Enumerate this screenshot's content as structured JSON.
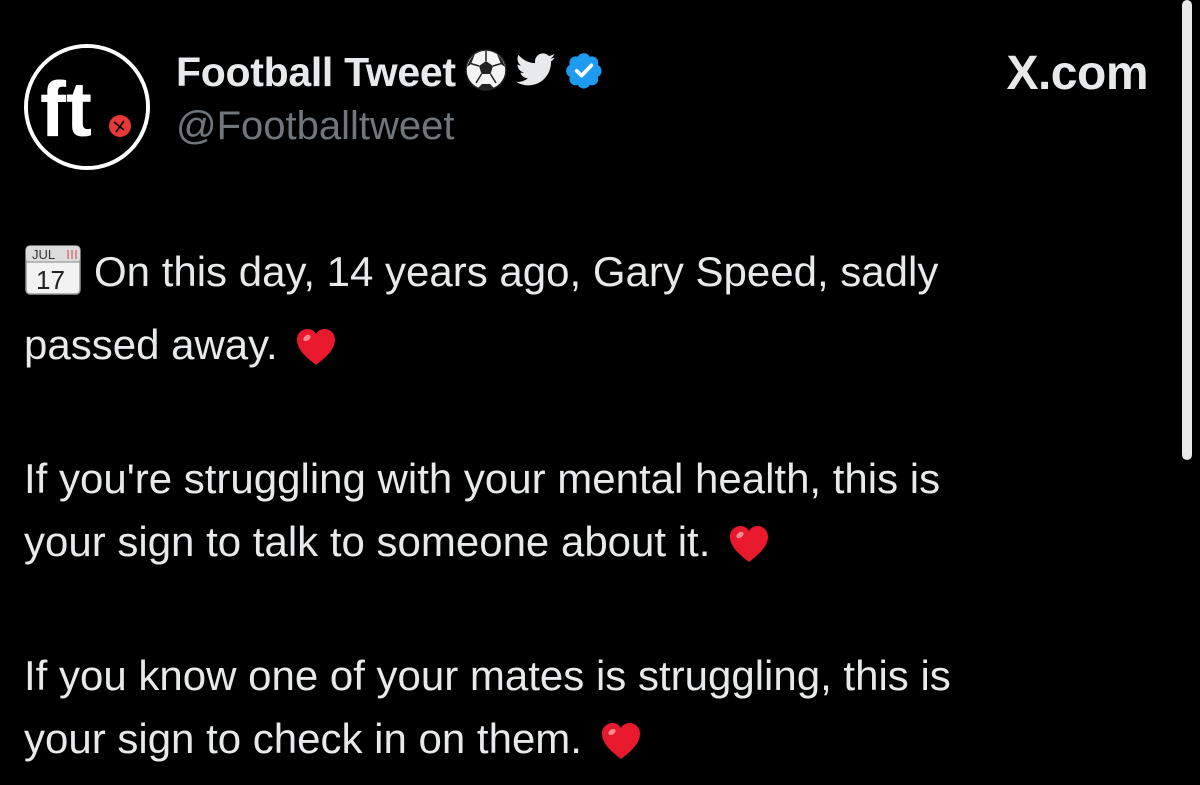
{
  "header": {
    "display_name": "Football Tweet",
    "handle": "@Footballtweet",
    "site_label": "X.com",
    "avatar_text": "ft",
    "icons": [
      "soccer-ball-icon",
      "twitter-bird-icon",
      "verified-badge-icon"
    ],
    "verified_color": "#1d9bf0"
  },
  "calendar_icon": {
    "month": "JUL",
    "day": "17"
  },
  "tweet": {
    "line_1": "On this day, 14 years ago, Gary Speed, sadly",
    "line_2": "passed away.",
    "line_3": "If you're struggling with your mental health, this is",
    "line_4": "your sign to talk to someone about it.",
    "line_5": "If you know one of your mates is struggling, this is",
    "line_6": "your sign to check in on them."
  },
  "colors": {
    "background": "#000000",
    "text_primary": "#e7e9ea",
    "text_secondary": "#71767b",
    "heart": "#e8192c",
    "avatar_accent": "#e53935"
  }
}
